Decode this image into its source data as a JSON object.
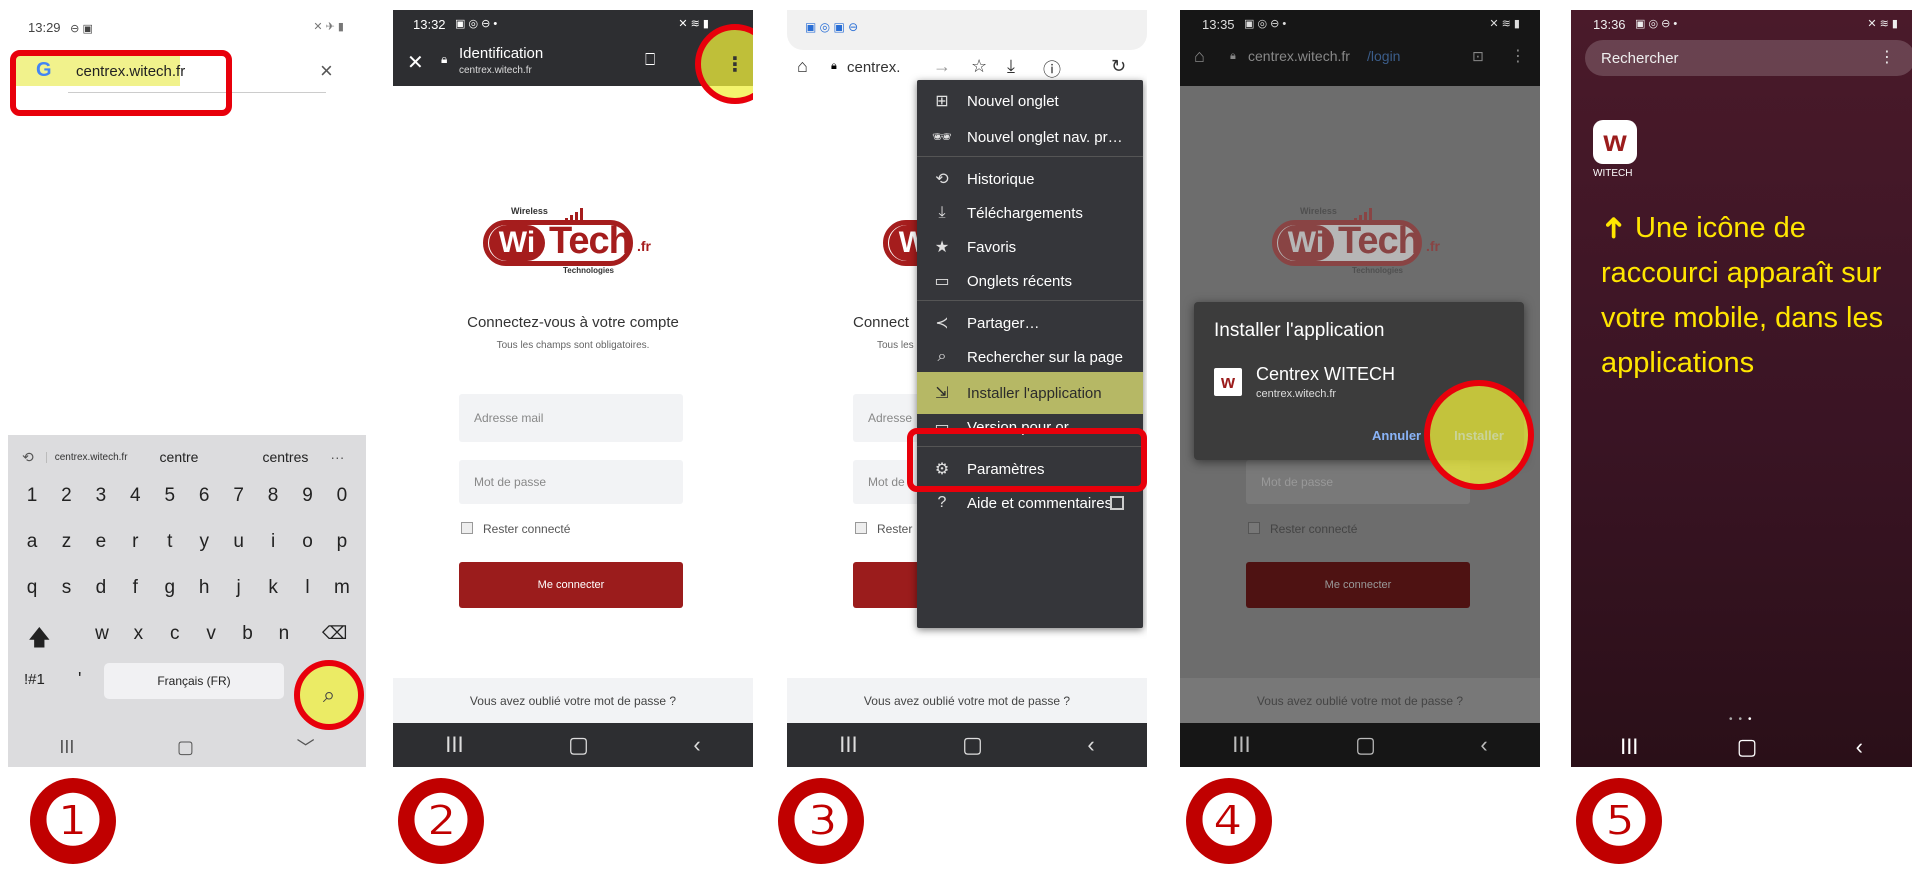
{
  "colors": {
    "accent_red": "#e8000b",
    "brand_red": "#9b1c1c",
    "highlight_yellow": "#eef078",
    "caption_yellow": "#ffe600"
  },
  "steps": [
    "❶",
    "❷",
    "❸",
    "❹",
    "❺"
  ],
  "panel1": {
    "time": "13:29",
    "url": "centrex.witech.fr",
    "suggestions": [
      "centrex.witech.fr",
      "centre",
      "centres",
      "···"
    ],
    "row_numbers": [
      "1",
      "2",
      "3",
      "4",
      "5",
      "6",
      "7",
      "8",
      "9",
      "0"
    ],
    "row_azerty": [
      "a",
      "z",
      "e",
      "r",
      "t",
      "y",
      "u",
      "i",
      "o",
      "p"
    ],
    "row_qsdf": [
      "q",
      "s",
      "d",
      "f",
      "g",
      "h",
      "j",
      "k",
      "l",
      "m"
    ],
    "row_wxcv": [
      "w",
      "x",
      "c",
      "v",
      "b",
      "n"
    ],
    "sym_key": "!#1",
    "apostrophe": "'",
    "space_label": "Français (FR)",
    "nav": [
      "III",
      "▢",
      "﹀"
    ]
  },
  "panel2": {
    "time": "13:32",
    "title": "Identification",
    "subtitle": "centrex.witech.fr",
    "heading": "Connectez-vous à votre compte",
    "note": "Tous les champs sont obligatoires.",
    "email_placeholder": "Adresse mail",
    "password_placeholder": "Mot de passe",
    "remember": "Rester connecté",
    "login_button": "Me connecter",
    "forgot": "Vous avez oublié votre mot de passe ?",
    "nav": [
      "III",
      "▢",
      "‹"
    ]
  },
  "logo": {
    "wireless": "Wireless",
    "wi": "Wi",
    "tech": "Tech",
    "fr": ".fr",
    "tagline": "Technologies"
  },
  "panel3": {
    "url": "centrex.",
    "bg_heading": "Connect",
    "bg_note": "Tous les",
    "bg_email": "Adresse",
    "bg_password": "Mot de",
    "bg_remember": "Rester",
    "forgot": "Vous avez oublié votre mot de passe ?",
    "menu": [
      {
        "icon": "⊞",
        "name": "new-tab-icon",
        "label": "Nouvel onglet"
      },
      {
        "icon": "🕶",
        "name": "incognito-icon",
        "label": "Nouvel onglet nav. pr…"
      },
      {
        "icon": "⟲",
        "name": "history-icon",
        "label": "Historique"
      },
      {
        "icon": "⤓",
        "name": "download-icon",
        "label": "Téléchargements"
      },
      {
        "icon": "★",
        "name": "star-icon",
        "label": "Favoris"
      },
      {
        "icon": "▭",
        "name": "tabs-icon",
        "label": "Onglets récents"
      },
      {
        "icon": "≺",
        "name": "share-icon",
        "label": "Partager…"
      },
      {
        "icon": "⌕",
        "name": "find-icon",
        "label": "Rechercher sur la page"
      },
      {
        "icon": "⇲",
        "name": "install-icon",
        "label": "Installer l'application"
      },
      {
        "icon": "▭",
        "name": "desktop-icon",
        "label": "Version pour or…"
      },
      {
        "icon": "⚙",
        "name": "settings-icon",
        "label": "Paramètres"
      },
      {
        "icon": "?",
        "name": "help-icon",
        "label": "Aide et commentaires"
      }
    ],
    "nav": [
      "III",
      "▢",
      "‹"
    ]
  },
  "panel4": {
    "time": "13:35",
    "url_host": "centrex.witech.fr",
    "url_path": "/login",
    "dialog_title": "Installer l'application",
    "app_name": "Centrex WITECH",
    "app_url": "centrex.witech.fr",
    "cancel": "Annuler",
    "install": "Installer",
    "password_placeholder": "Mot de passe",
    "remember": "Rester connecté",
    "login_button": "Me connecter",
    "forgot": "Vous avez oublié votre mot de passe ?",
    "nav": [
      "III",
      "▢",
      "‹"
    ]
  },
  "panel5": {
    "time": "13:36",
    "search_placeholder": "Rechercher",
    "app_label": "WITECH",
    "caption_arrow": "➜",
    "caption": "Une icône de raccourci apparaît sur votre mobile, dans les applications",
    "nav": [
      "III",
      "▢",
      "‹"
    ]
  }
}
